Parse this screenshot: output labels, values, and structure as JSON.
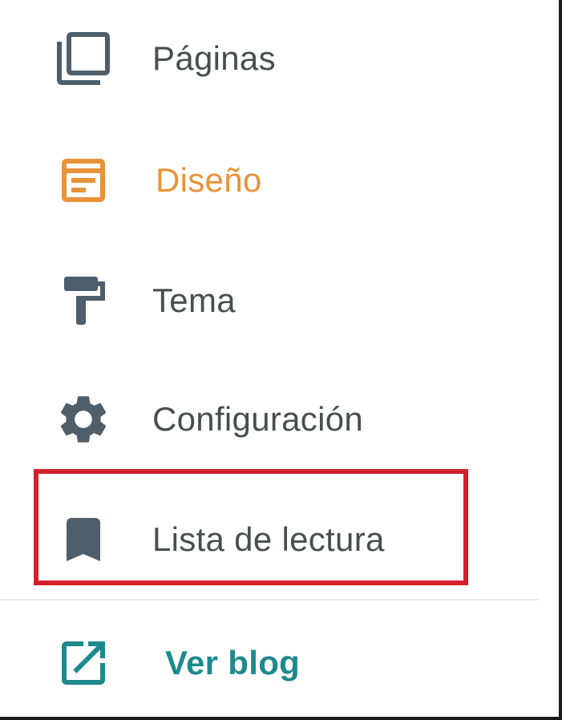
{
  "nav": {
    "items": [
      {
        "id": "paginas",
        "label": "Páginas",
        "icon": "pages-icon",
        "active": false
      },
      {
        "id": "diseno",
        "label": "Diseño",
        "icon": "layout-icon",
        "active": true
      },
      {
        "id": "tema",
        "label": "Tema",
        "icon": "paint-roller-icon",
        "active": false
      },
      {
        "id": "configuracion",
        "label": "Configuración",
        "icon": "gear-icon",
        "active": false
      },
      {
        "id": "lista",
        "label": "Lista de lectura",
        "icon": "bookmark-icon",
        "active": false,
        "highlighted": true
      }
    ],
    "footer_link": {
      "label": "Ver blog",
      "icon": "open-in-new-icon"
    }
  },
  "colors": {
    "icon_default": "#4f5e6b",
    "active": "#e8923a",
    "link": "#1e8a8e",
    "text": "#4a4d50",
    "highlight": "#d4202c"
  }
}
